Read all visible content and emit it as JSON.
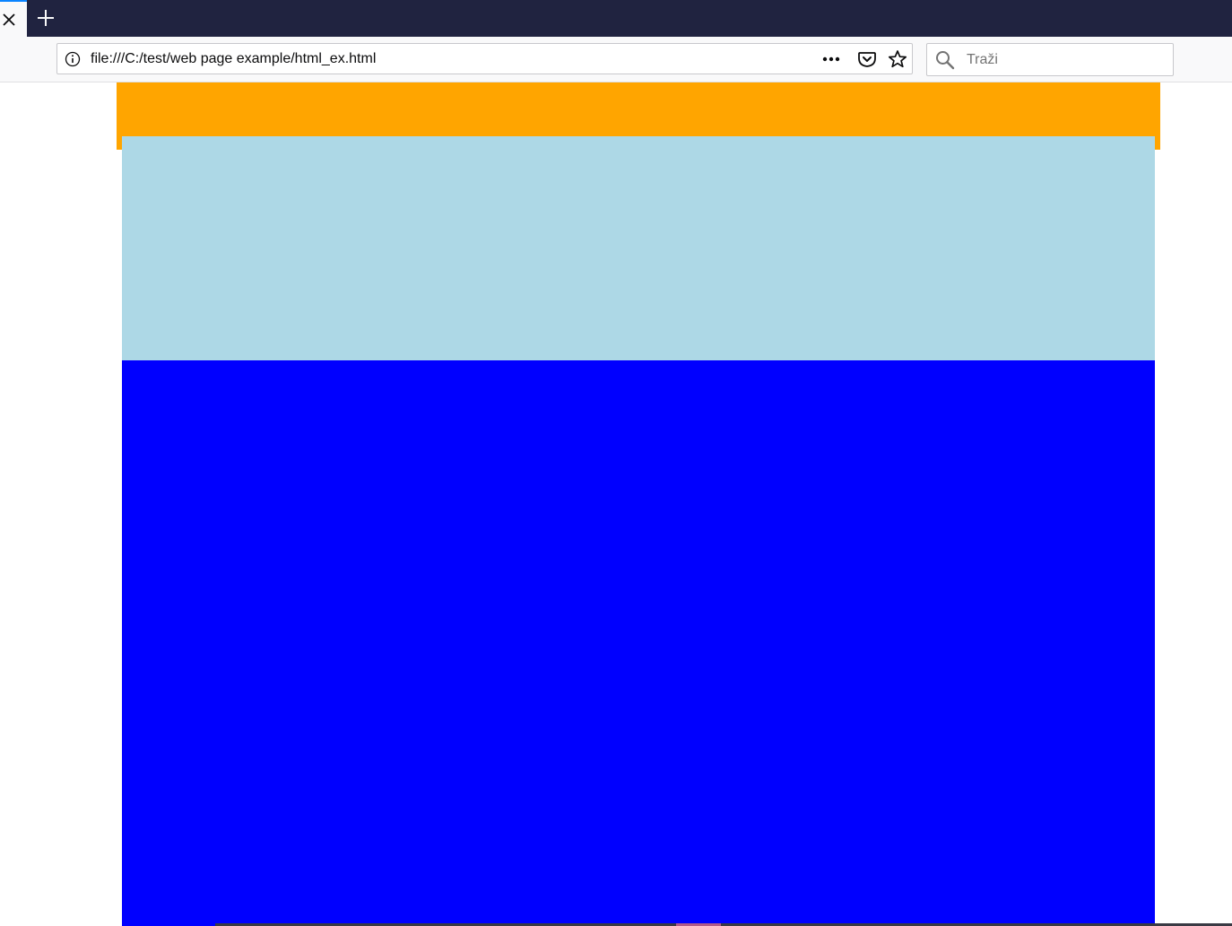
{
  "browser": {
    "tab_close_icon": "close-icon",
    "new_tab_icon": "plus-icon",
    "url": "file:///C:/test/web page example/html_ex.html",
    "page_actions_icon": "ellipsis-icon",
    "pocket_icon": "pocket-icon",
    "bookmark_icon": "star-icon",
    "search_placeholder": "Traži",
    "colors": {
      "tabbar": "#202340",
      "toolbar": "#f9f9fa"
    }
  },
  "page": {
    "colors": {
      "header": "#ffa500",
      "section_light": "#add8e6",
      "section_main": "#0000ff"
    }
  }
}
